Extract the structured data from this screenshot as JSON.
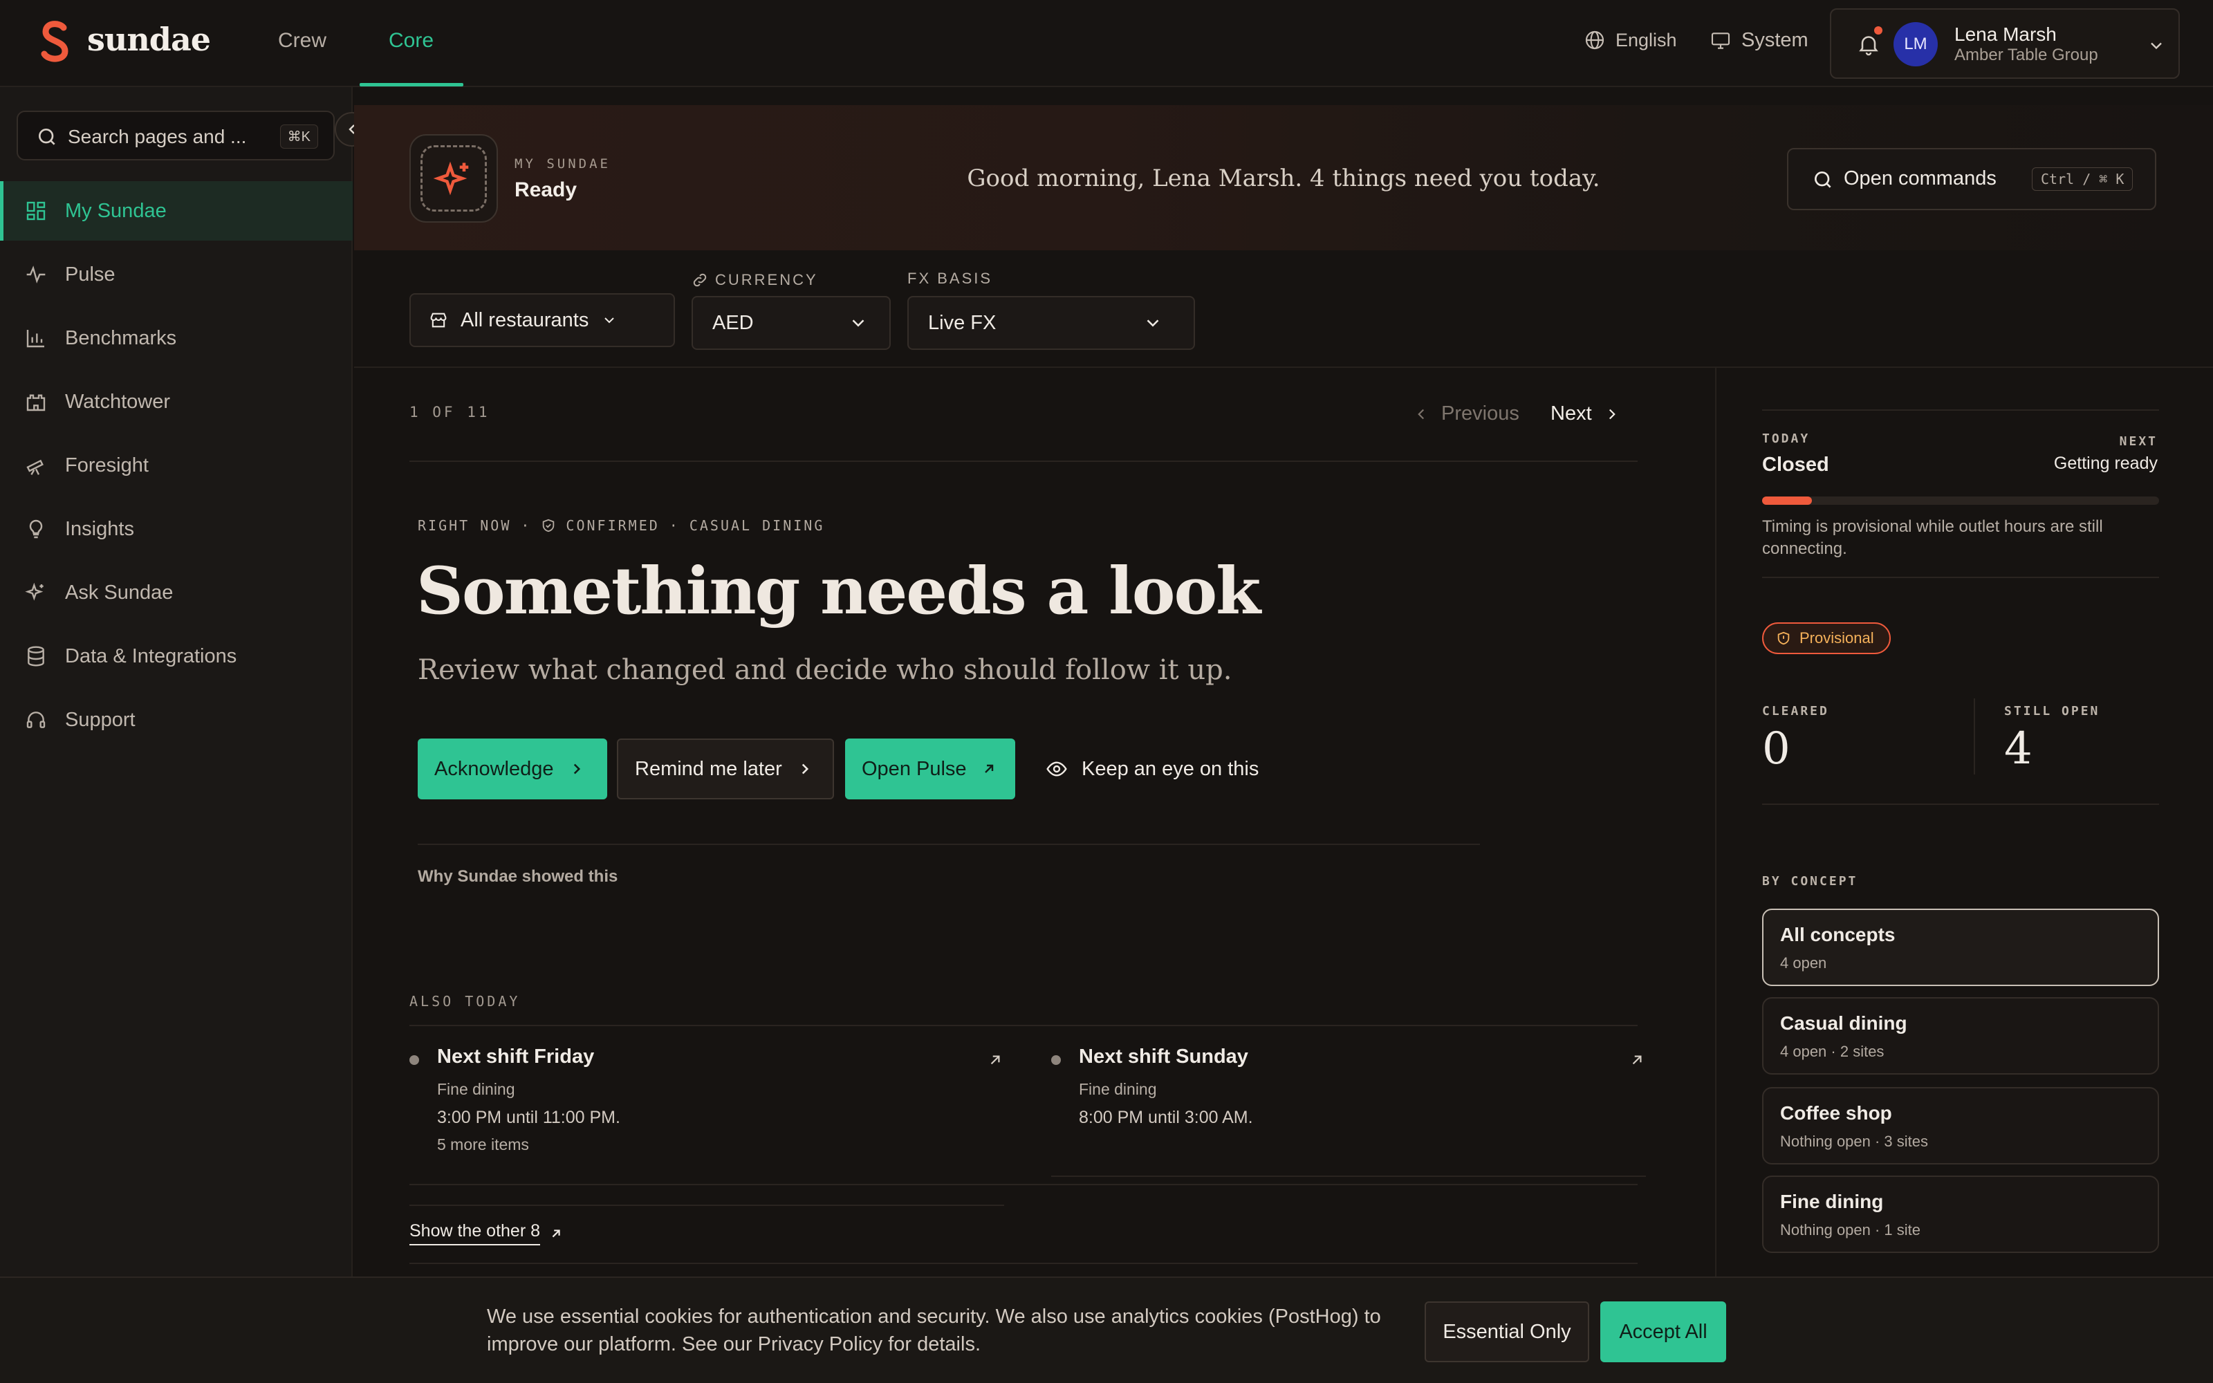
{
  "brand": {
    "name": "sundae",
    "mark_color": "#ef5a3c",
    "accent": "#2fc493"
  },
  "topnav": {
    "tabs": [
      {
        "label": "Crew"
      },
      {
        "label": "Core",
        "active": true
      }
    ],
    "language": "English",
    "theme": "System",
    "user": {
      "initials": "LM",
      "name": "Lena Marsh",
      "org": "Amber Table Group"
    }
  },
  "sidebar": {
    "search_placeholder": "Search pages and ...",
    "search_shortcut": "⌘K",
    "items": [
      {
        "label": "My Sundae",
        "icon": "dashboard-icon",
        "active": true
      },
      {
        "label": "Pulse",
        "icon": "pulse-icon"
      },
      {
        "label": "Benchmarks",
        "icon": "bar-chart-icon"
      },
      {
        "label": "Watchtower",
        "icon": "castle-icon"
      },
      {
        "label": "Foresight",
        "icon": "telescope-icon"
      },
      {
        "label": "Insights",
        "icon": "lightbulb-icon"
      },
      {
        "label": "Ask Sundae",
        "icon": "sparkles-icon"
      },
      {
        "label": "Data & Integrations",
        "icon": "database-icon"
      },
      {
        "label": "Support",
        "icon": "headset-icon"
      }
    ]
  },
  "hero": {
    "kicker": "MY SUNDAE",
    "status": "Ready",
    "greeting": "Good morning, Lena Marsh. 4 things need you today.",
    "command_label": "Open commands",
    "command_shortcut": "Ctrl / ⌘ K"
  },
  "filters": {
    "restaurants": "All restaurants",
    "currency_label": "CURRENCY",
    "currency": "AED",
    "fx_label": "FX BASIS",
    "fx": "Live FX"
  },
  "feed": {
    "counter": "1 OF 11",
    "prev": "Previous",
    "next": "Next",
    "crumb_now": "RIGHT NOW",
    "crumb_confirmed": "CONFIRMED",
    "crumb_concept": "CASUAL DINING",
    "headline": "Something needs a look",
    "subline": "Review what changed and decide who should follow it up.",
    "actions": {
      "acknowledge": "Acknowledge",
      "remind": "Remind me later",
      "open_pulse": "Open Pulse",
      "watch": "Keep an eye on this"
    },
    "why": "Why Sundae showed this",
    "also_label": "ALSO TODAY",
    "cards": [
      {
        "title": "Next shift Friday",
        "concept": "Fine dining",
        "time": "3:00 PM until 11:00 PM.",
        "more": "5 more items"
      },
      {
        "title": "Next shift Sunday",
        "concept": "Fine dining",
        "time": "8:00 PM until 3:00 AM."
      }
    ],
    "show_more": "Show the other 8"
  },
  "panel": {
    "today_label": "TODAY",
    "today_value": "Closed",
    "next_label": "NEXT",
    "next_value": "Getting ready",
    "progress": 0.125,
    "note": "Timing is provisional while outlet hours are still connecting.",
    "badge": "Provisional",
    "cleared_label": "CLEARED",
    "cleared": "0",
    "open_label": "STILL OPEN",
    "open": "4",
    "concept_label": "BY CONCEPT",
    "concepts": [
      {
        "name": "All concepts",
        "sub": "4 open",
        "active": true
      },
      {
        "name": "Casual dining",
        "sub": "4 open · 2 sites"
      },
      {
        "name": "Coffee shop",
        "sub": "Nothing open · 3 sites"
      },
      {
        "name": "Fine dining",
        "sub": "Nothing open · 1 site"
      }
    ]
  },
  "cookie": {
    "text": "We use essential cookies for authentication and security. We also use analytics cookies (PostHog) to improve our platform. See our Privacy Policy for details.",
    "essential": "Essential Only",
    "accept": "Accept All"
  }
}
